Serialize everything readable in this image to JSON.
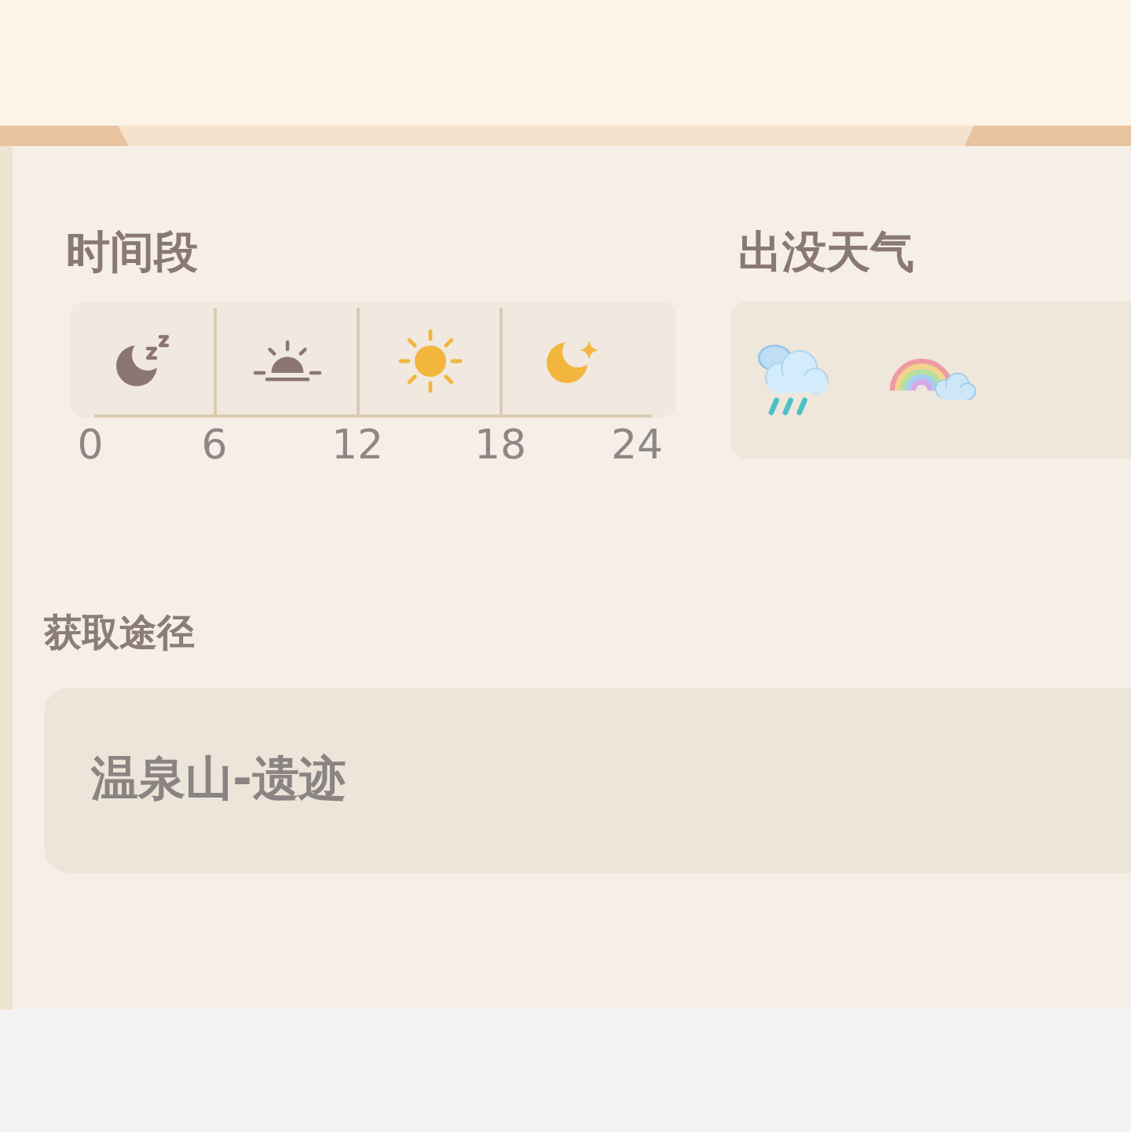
{
  "time_period": {
    "title": "时间段",
    "periods": [
      {
        "active": false
      },
      {
        "active": false
      },
      {
        "active": true
      },
      {
        "active": true
      }
    ],
    "ticks": [
      "0",
      "6",
      "12",
      "18",
      "24"
    ]
  },
  "weather": {
    "title": "出没天气",
    "items": [
      {
        "kind": "rain"
      },
      {
        "kind": "rainbow"
      }
    ]
  },
  "source": {
    "title": "获取途径",
    "locations": [
      "温泉山-遗迹"
    ]
  }
}
